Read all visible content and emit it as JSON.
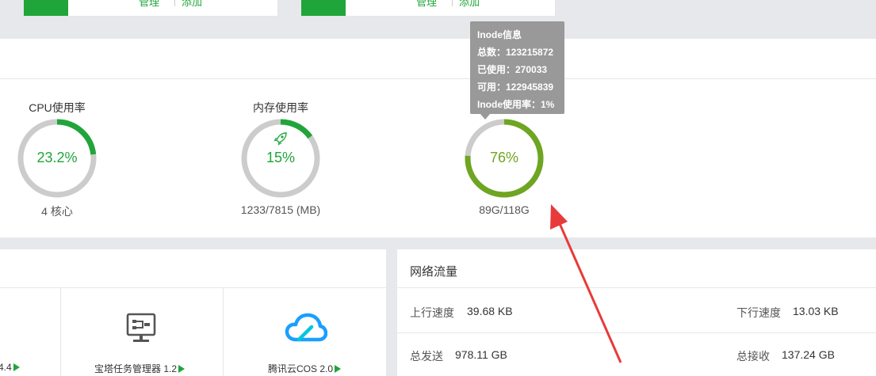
{
  "top_cards": [
    {
      "links": [
        "管理",
        "添加"
      ]
    },
    {
      "links": [
        "管理",
        "添加"
      ]
    }
  ],
  "status": {
    "gauges": [
      {
        "title": "CPU使用率",
        "value": "23.2%",
        "percent": 23.2,
        "subtitle": "4 核心",
        "color": "#20a53a",
        "icon": ""
      },
      {
        "title": "内存使用率",
        "value": "15%",
        "percent": 15,
        "subtitle": "1233/7815 (MB)",
        "color": "#20a53a",
        "icon": "rocket-icon"
      },
      {
        "title": "",
        "value": "76%",
        "percent": 76,
        "subtitle": "89G/118G",
        "color": "#6ea521",
        "icon": ""
      }
    ],
    "tooltip": {
      "title": "Inode信息",
      "total": "总数：123215872",
      "used": "已使用：270033",
      "available": "可用：122945839",
      "usage": "Inode使用率：1%"
    }
  },
  "software": {
    "items": [
      {
        "name": "",
        "version": "4.4",
        "icon": "partial-item"
      },
      {
        "name": "宝塔任务管理器",
        "version": "1.2",
        "icon": "monitor-icon"
      },
      {
        "name": "腾讯云COS",
        "version": "2.0",
        "icon": "cloud-icon"
      }
    ]
  },
  "network": {
    "title": "网络流量",
    "upload_label": "上行速度",
    "upload_value": "39.68 KB",
    "download_label": "下行速度",
    "download_value": "13.03 KB",
    "sent_label": "总发送",
    "sent_value": "978.11 GB",
    "received_label": "总接收",
    "received_value": "137.24 GB"
  },
  "colors": {
    "brand": "#20a53a",
    "disk": "#6ea521",
    "track": "#cccccc",
    "annotation_arrow": "#e83a3a"
  }
}
